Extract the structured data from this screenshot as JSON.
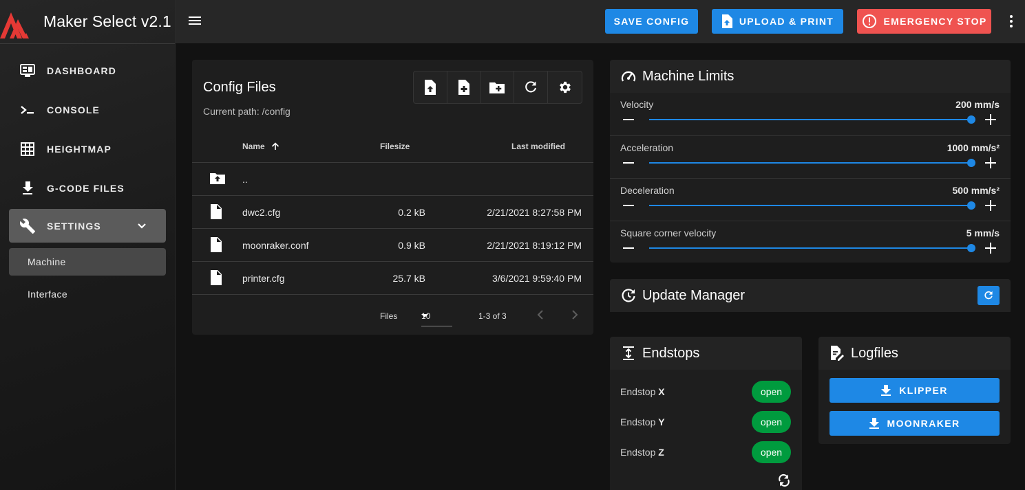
{
  "app": {
    "title": "Maker Select v2.1"
  },
  "sidebar": {
    "items": [
      {
        "label": "DASHBOARD",
        "icon": "monitor-dashboard-icon"
      },
      {
        "label": "CONSOLE",
        "icon": "console-icon"
      },
      {
        "label": "HEIGHTMAP",
        "icon": "grid-icon"
      },
      {
        "label": "G-CODE FILES",
        "icon": "file-download-icon"
      },
      {
        "label": "SETTINGS",
        "icon": "wrench-icon"
      }
    ],
    "settings_sub": [
      {
        "label": "Machine"
      },
      {
        "label": "Interface"
      }
    ]
  },
  "toolbar": {
    "save_config": "SAVE CONFIG",
    "upload_print": "UPLOAD & PRINT",
    "emergency_stop": "EMERGENCY STOP"
  },
  "config_files": {
    "title": "Config Files",
    "current_path": "Current path: /config",
    "columns": {
      "name": "Name",
      "filesize": "Filesize",
      "last_modified": "Last modified"
    },
    "parent": "..",
    "files": [
      {
        "name": "dwc2.cfg",
        "size": "0.2 kB",
        "modified": "2/21/2021 8:27:58 PM"
      },
      {
        "name": "moonraker.conf",
        "size": "0.9 kB",
        "modified": "2/21/2021 8:19:12 PM"
      },
      {
        "name": "printer.cfg",
        "size": "25.7 kB",
        "modified": "3/6/2021 9:59:40 PM"
      }
    ],
    "footer": {
      "files_label": "Files",
      "per_page": "10",
      "range": "1-3 of 3"
    }
  },
  "machine_limits": {
    "title": "Machine Limits",
    "rows": [
      {
        "label": "Velocity",
        "value": "200 mm/s",
        "level": 1.0
      },
      {
        "label": "Acceleration",
        "value": "1000 mm/s²",
        "level": 1.0
      },
      {
        "label": "Deceleration",
        "value": "500 mm/s²",
        "level": 1.0
      },
      {
        "label": "Square corner velocity",
        "value": "5 mm/s",
        "level": 1.0
      }
    ]
  },
  "update_manager": {
    "title": "Update Manager"
  },
  "endstops": {
    "title": "Endstops",
    "rows": [
      {
        "label": "Endstop",
        "axis": "X",
        "state": "open"
      },
      {
        "label": "Endstop",
        "axis": "Y",
        "state": "open"
      },
      {
        "label": "Endstop",
        "axis": "Z",
        "state": "open"
      }
    ]
  },
  "logfiles": {
    "title": "Logfiles",
    "buttons": [
      {
        "label": "KLIPPER"
      },
      {
        "label": "MOONRAKER"
      }
    ]
  },
  "colors": {
    "accent": "#1e88e5",
    "danger": "#ef5350",
    "success": "#009b3e"
  }
}
